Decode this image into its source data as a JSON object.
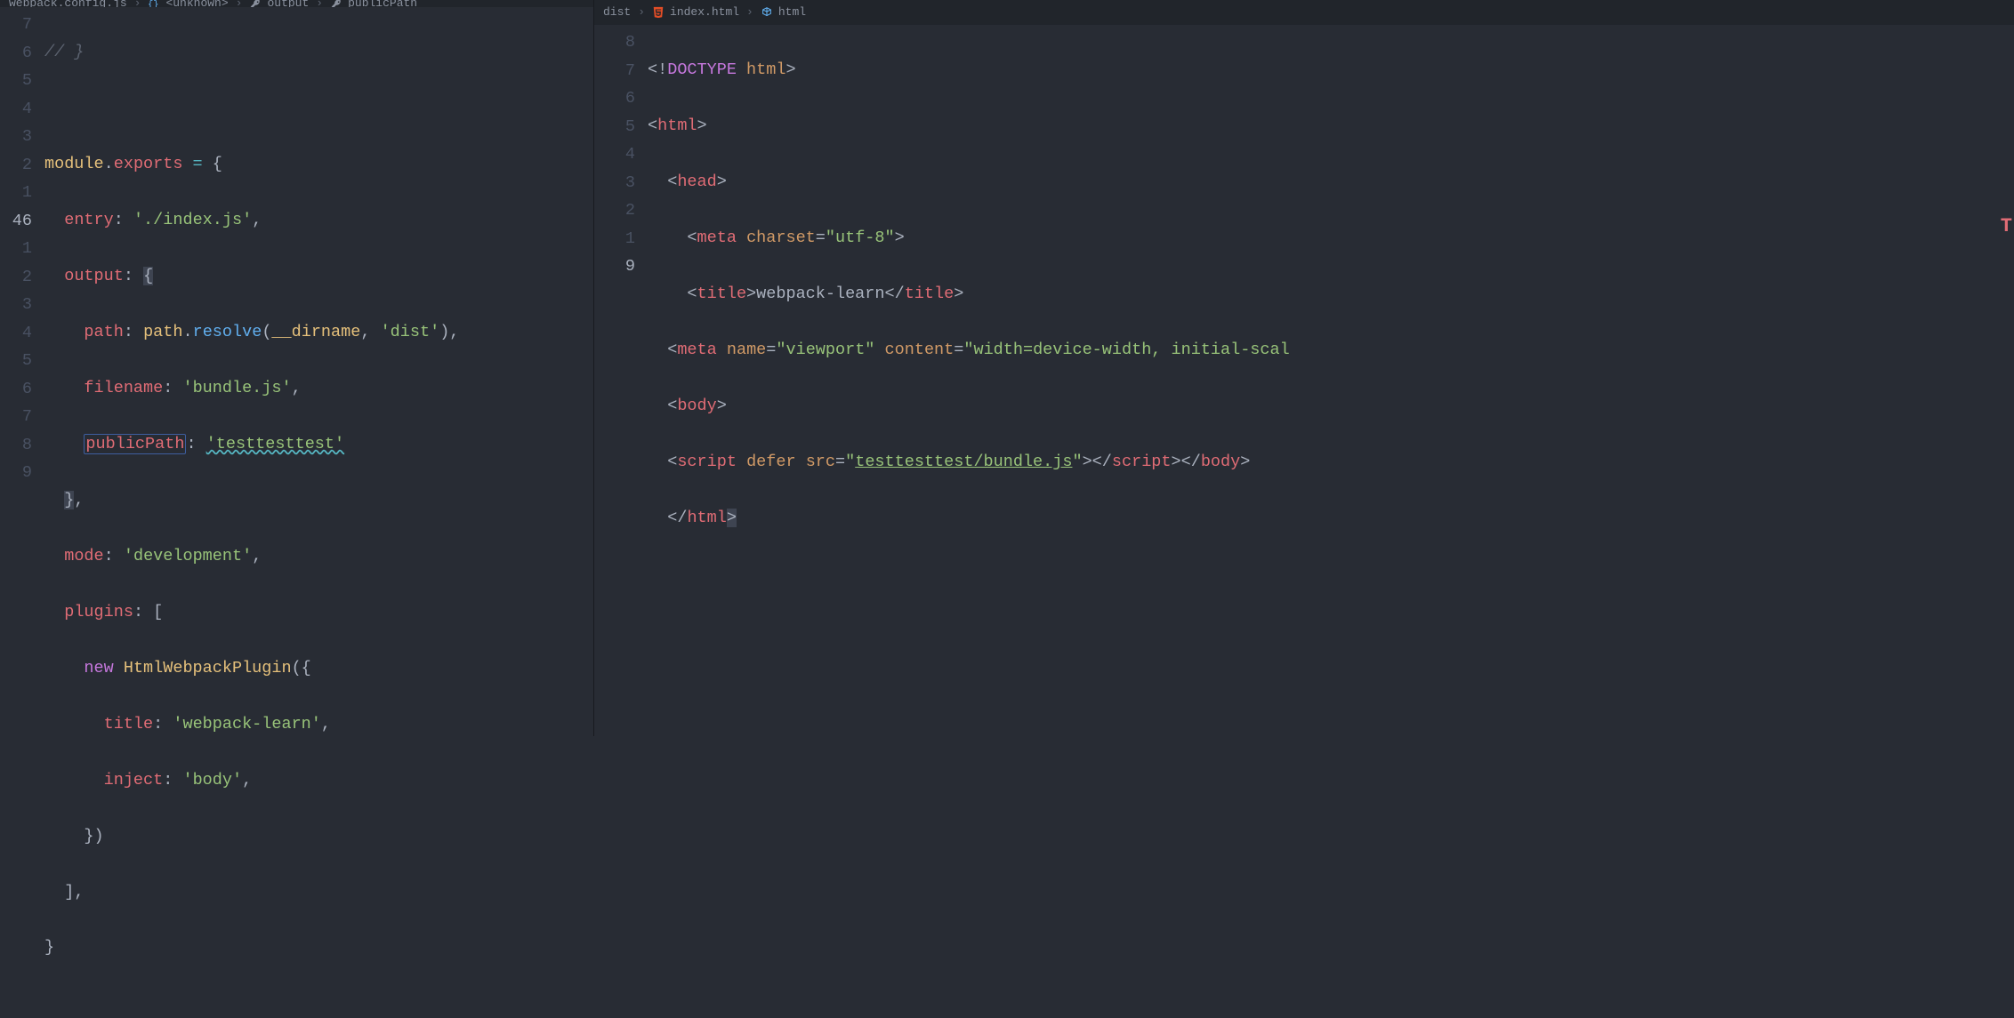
{
  "left": {
    "breadcrumb": {
      "file": "webpack.config.js",
      "seg1": "<unknown>",
      "seg2": "output",
      "seg3": "publicPath"
    },
    "gutter": [
      "7",
      "6",
      "5",
      "4",
      "3",
      "2",
      "1",
      "46",
      "1",
      "2",
      "3",
      "4",
      "5",
      "6",
      "7",
      "8",
      "9"
    ],
    "currentLineIndex": 7,
    "lines": [
      {
        "type": "comment",
        "text": "// }"
      },
      {
        "type": "blank",
        "text": ""
      },
      {
        "type": "module_exports"
      },
      {
        "type": "entry"
      },
      {
        "type": "output_open"
      },
      {
        "type": "path_line"
      },
      {
        "type": "filename_line"
      },
      {
        "type": "publicpath_line"
      },
      {
        "type": "close_brace_comma",
        "indent": 1
      },
      {
        "type": "mode_line"
      },
      {
        "type": "plugins_open"
      },
      {
        "type": "new_plugin"
      },
      {
        "type": "title_line"
      },
      {
        "type": "inject_line"
      },
      {
        "type": "close_paren",
        "indent": 2
      },
      {
        "type": "close_bracket_comma",
        "indent": 1
      },
      {
        "type": "close_brace",
        "indent": 0
      }
    ],
    "values": {
      "module": "module",
      "exports": "exports",
      "equals": " = ",
      "entry_key": "entry",
      "entry_val": "'./index.js'",
      "output_key": "output",
      "path_key": "path",
      "path_obj": "path",
      "resolve": "resolve",
      "dirname": "__dirname",
      "dist": "'dist'",
      "filename_key": "filename",
      "filename_val": "'bundle.js'",
      "publicPath_key": "publicPath",
      "publicPath_val": "'testtesttest'",
      "mode_key": "mode",
      "mode_val": "'development'",
      "plugins_key": "plugins",
      "new_kw": "new",
      "plugin_name": "HtmlWebpackPlugin",
      "title_key": "title",
      "title_val": "'webpack-learn'",
      "inject_key": "inject",
      "inject_val": "'body'"
    }
  },
  "right": {
    "breadcrumb": {
      "folder": "dist",
      "file": "index.html",
      "seg1": "html"
    },
    "gutter": [
      "8",
      "7",
      "6",
      "5",
      "4",
      "3",
      "2",
      "1",
      "9"
    ],
    "currentLineIndex": 8,
    "values": {
      "doctype": "DOCTYPE",
      "html_kw": "html",
      "head": "head",
      "meta": "meta",
      "charset_attr": "charset",
      "charset_val": "\"utf-8\"",
      "title_tag": "title",
      "title_text": "webpack-learn",
      "name_attr": "name",
      "viewport": "\"viewport\"",
      "content_attr": "content",
      "content_val": "\"width=device-width, initial-scal",
      "body": "body",
      "script": "script",
      "defer": "defer",
      "src_attr": "src",
      "src_val": "\"testtesttest/bundle.js\"",
      "src_val_inner": "testtesttest/bundle.js"
    }
  }
}
